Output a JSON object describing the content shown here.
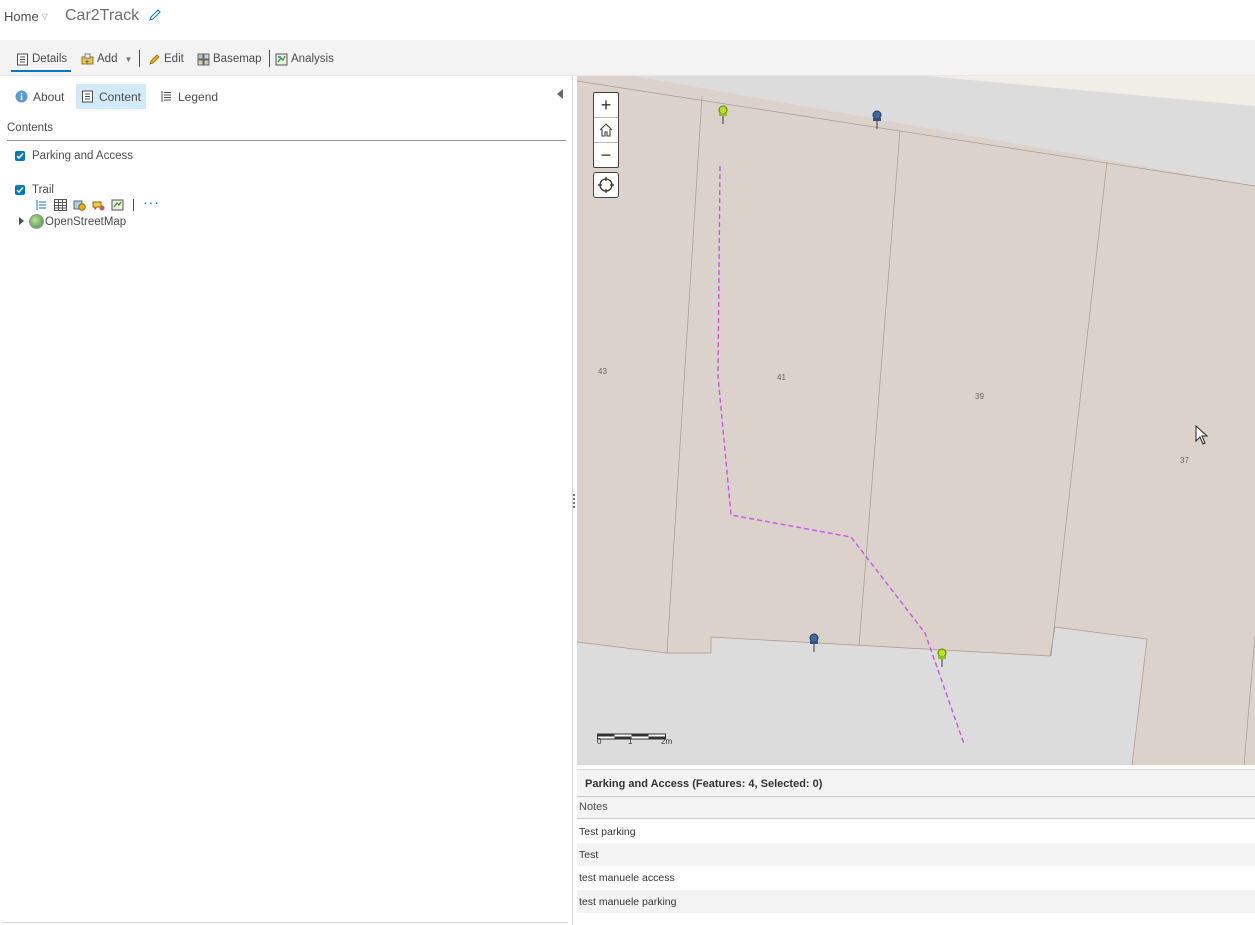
{
  "header": {
    "home_label": "Home",
    "map_title": "Car2Track"
  },
  "toolbar": {
    "details_label": "Details",
    "add_label": "Add",
    "edit_label": "Edit",
    "basemap_label": "Basemap",
    "analysis_label": "Analysis"
  },
  "panel": {
    "tabs": [
      {
        "label": "About",
        "icon": "info-icon"
      },
      {
        "label": "Content",
        "icon": "content-icon",
        "active": true
      },
      {
        "label": "Legend",
        "icon": "legend-icon"
      }
    ],
    "contents_title": "Contents",
    "layers": [
      {
        "label": "Parking and Access",
        "checked": true
      },
      {
        "label": "Trail",
        "checked": true
      },
      {
        "label": "OpenStreetMap",
        "icon": "globe-icon",
        "expandable": true
      }
    ]
  },
  "map": {
    "house_numbers": [
      "43",
      "41",
      "39",
      "37"
    ],
    "scalebar": {
      "labels": [
        "0",
        "1",
        "2m"
      ]
    },
    "colors": {
      "parcel": "#dcd2cc",
      "road": "#dcdcdc",
      "trail": "#c456e8"
    }
  },
  "attribute_table": {
    "title": "Parking and Access (Features: 4, Selected: 0)",
    "column": "Notes",
    "rows": [
      "Test parking",
      "Test",
      "test manuele access",
      "test manuele parking"
    ]
  },
  "colors": {
    "accent": "#0079c1",
    "tab_active_bg": "#d2e9f9"
  }
}
